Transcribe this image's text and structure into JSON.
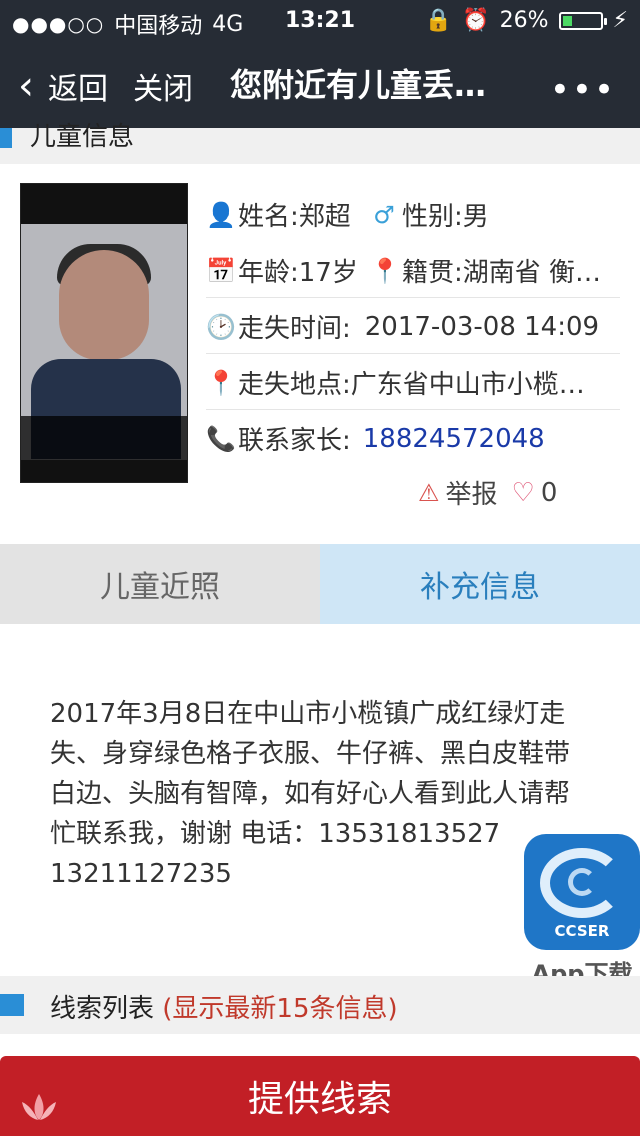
{
  "status_bar": {
    "carrier": "中国移动",
    "network": "4G",
    "time": "13:21",
    "battery": "26%",
    "battery_level": 0.26
  },
  "nav": {
    "back_label": "返回",
    "close_label": "关闭",
    "title": "您附近有儿童丢…",
    "more": "•••"
  },
  "section_top": {
    "label": "儿童信息"
  },
  "child": {
    "name": "姓名:郑超",
    "gender": "性别:男",
    "age": "年龄:17岁",
    "origin": "籍贯:湖南省 衡…",
    "lost_time_label": "走失时间:",
    "lost_time_value": "2017-03-08 14:09",
    "lost_place": "走失地点:广东省中山市小榄…",
    "contact_label": "联系家长:",
    "contact_phone": "18824572048"
  },
  "report": {
    "label": "举报",
    "likes": "0"
  },
  "tabs": [
    {
      "label": "儿童近照"
    },
    {
      "label": "补充信息"
    }
  ],
  "description": "2017年3月8日在中山市小榄镇广成红绿灯走失、身穿绿色格子衣服、牛仔裤、黑白皮鞋带白边、头脑有智障，如有好心人看到此人请帮忙联系我，谢谢 电话：13531813527 13211127235",
  "app_badge": {
    "label": "CCSER",
    "download": "App下载"
  },
  "list_header": {
    "title": "线索列表",
    "subtitle": "(显示最新15条信息)"
  },
  "submit": {
    "label": "提供线索"
  },
  "colors": {
    "nav_bg": "#262c35",
    "accent_blue": "#2a8ed6",
    "submit_red": "#c21f26"
  }
}
